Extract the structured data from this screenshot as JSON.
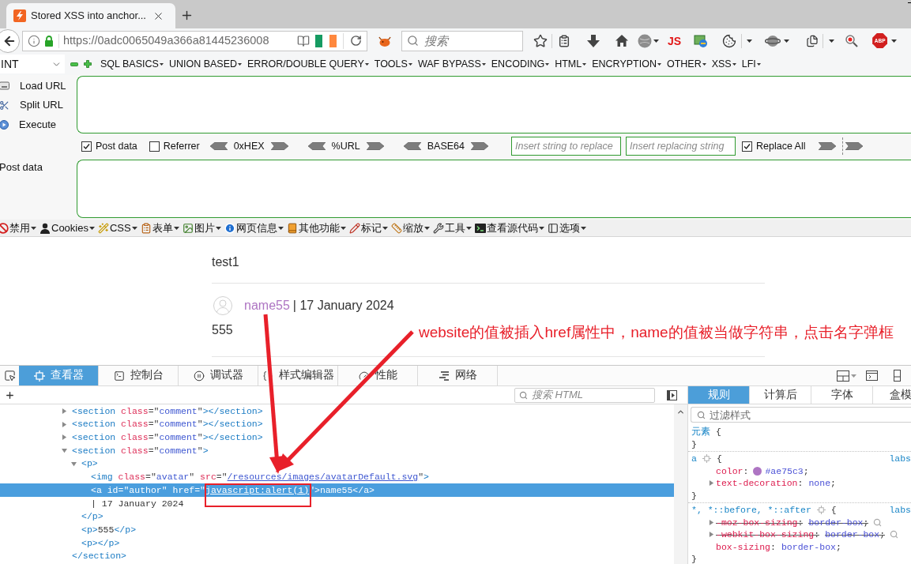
{
  "browser": {
    "tabs": [
      {
        "title": "Stored XSS into anchor...",
        "selected": true
      }
    ],
    "url": "https://0adc0065049a366a81445236008",
    "search_placeholder": "搜索",
    "js_label": "JS",
    "abp_label": "ABP"
  },
  "hackbar": {
    "load_type": "INT",
    "menus": [
      "SQL BASICS",
      "UNION BASED",
      "ERROR/DOUBLE QUERY",
      "TOOLS",
      "WAF BYPASS",
      "ENCODING",
      "HTML",
      "ENCRYPTION",
      "OTHER",
      "XSS",
      "LFI"
    ],
    "actions": [
      "Load URL",
      "Split URL",
      "Execute"
    ],
    "checkboxes": [
      {
        "label": "Post data",
        "checked": true
      },
      {
        "label": "Referrer",
        "checked": false
      }
    ],
    "encoders": [
      "0xHEX",
      "%URL",
      "BASE64"
    ],
    "replace_from_placeholder": "Insert string to replace",
    "replace_to_placeholder": "Insert replacing string",
    "replace_all": {
      "label": "Replace All",
      "checked": true
    },
    "post_data_label": "Post data"
  },
  "dev_toolbar": [
    "禁用",
    "Cookies",
    "CSS",
    "表单",
    "图片",
    "网页信息",
    "其他功能",
    "标记",
    "缩放",
    "工具",
    "查看源代码",
    "选项"
  ],
  "page": {
    "comments": [
      {
        "body": "test1"
      },
      {
        "author": "name55",
        "meta": "| 17 January 2024",
        "body": "555"
      }
    ]
  },
  "annotation": "website的值被插入href属性中，name的值被当做字符串，点击名字弹框",
  "devtools": {
    "tabs": [
      {
        "label": "查看器",
        "selected": true
      },
      {
        "label": "控制台",
        "selected": false
      },
      {
        "label": "调试器",
        "selected": false
      },
      {
        "label": "样式编辑器",
        "selected": false
      },
      {
        "label": "性能",
        "selected": false
      },
      {
        "label": "网络",
        "selected": false
      }
    ],
    "search_placeholder": "搜索 HTML",
    "markup": [
      {
        "kind": "parent",
        "expanded": false,
        "selected": false,
        "tokens": [
          {
            "kind": "tag",
            "text": "<section"
          },
          {
            "kind": "attr",
            "text": " class"
          },
          {
            "kind": "punct",
            "text": "=\""
          },
          {
            "kind": "value",
            "text": "comment"
          },
          {
            "kind": "punct",
            "text": "\""
          },
          {
            "kind": "tag",
            "text": "></section>"
          }
        ]
      },
      {
        "kind": "parent",
        "expanded": false,
        "selected": false,
        "tokens": [
          {
            "kind": "tag",
            "text": "<section"
          },
          {
            "kind": "attr",
            "text": " class"
          },
          {
            "kind": "punct",
            "text": "=\""
          },
          {
            "kind": "value",
            "text": "comment"
          },
          {
            "kind": "punct",
            "text": "\""
          },
          {
            "kind": "tag",
            "text": "></section>"
          }
        ]
      },
      {
        "kind": "parent",
        "expanded": false,
        "selected": false,
        "tokens": [
          {
            "kind": "tag",
            "text": "<section"
          },
          {
            "kind": "attr",
            "text": " class"
          },
          {
            "kind": "punct",
            "text": "=\""
          },
          {
            "kind": "value",
            "text": "comment"
          },
          {
            "kind": "punct",
            "text": "\""
          },
          {
            "kind": "tag",
            "text": "></section>"
          }
        ]
      },
      {
        "kind": "parent",
        "expanded": true,
        "selected": false,
        "tokens": [
          {
            "kind": "tag",
            "text": "<section"
          },
          {
            "kind": "attr",
            "text": " class"
          },
          {
            "kind": "punct",
            "text": "=\""
          },
          {
            "kind": "value",
            "text": "comment"
          },
          {
            "kind": "punct",
            "text": "\""
          },
          {
            "kind": "tag",
            "text": ">"
          }
        ],
        "children": [
          {
            "kind": "parent",
            "expanded": true,
            "selected": false,
            "tokens": [
              {
                "kind": "tag",
                "text": "<p>"
              }
            ],
            "children": [
              {
                "kind": "leaf",
                "selected": false,
                "tokens": [
                  {
                    "kind": "tag",
                    "text": "<img"
                  },
                  {
                    "kind": "attr",
                    "text": " class"
                  },
                  {
                    "kind": "punct",
                    "text": "=\""
                  },
                  {
                    "kind": "value",
                    "text": "avatar"
                  },
                  {
                    "kind": "punct",
                    "text": "\""
                  },
                  {
                    "kind": "attr",
                    "text": " src"
                  },
                  {
                    "kind": "punct",
                    "text": "=\""
                  },
                  {
                    "kind": "link",
                    "text": "/resources/images/avatarDefault.svg"
                  },
                  {
                    "kind": "punct",
                    "text": "\""
                  },
                  {
                    "kind": "tag",
                    "text": ">"
                  }
                ]
              },
              {
                "kind": "leaf",
                "selected": true,
                "tokens": [
                  {
                    "kind": "tag",
                    "text": "<a"
                  },
                  {
                    "kind": "attr",
                    "text": " id"
                  },
                  {
                    "kind": "punct",
                    "text": "=\""
                  },
                  {
                    "kind": "value",
                    "text": "author"
                  },
                  {
                    "kind": "punct",
                    "text": "\""
                  },
                  {
                    "kind": "attr",
                    "text": " href"
                  },
                  {
                    "kind": "punct",
                    "text": "=\""
                  },
                  {
                    "kind": "link",
                    "text": "javascript:alert(1)"
                  },
                  {
                    "kind": "punct",
                    "text": "\""
                  },
                  {
                    "kind": "tag",
                    "text": ">"
                  },
                  {
                    "kind": "text",
                    "text": "name55"
                  },
                  {
                    "kind": "tag",
                    "text": "</a>"
                  }
                ]
              },
              {
                "kind": "leaf",
                "selected": false,
                "tokens": [
                  {
                    "kind": "text",
                    "text": "| 17 January 2024"
                  }
                ]
              }
            ],
            "closing": [
              {
                "kind": "tag",
                "text": "</p>"
              }
            ]
          },
          {
            "kind": "leaf",
            "selected": false,
            "tokens": [
              {
                "kind": "tag",
                "text": "<p>"
              },
              {
                "kind": "text",
                "text": "555"
              },
              {
                "kind": "tag",
                "text": "</p>"
              }
            ]
          },
          {
            "kind": "leaf",
            "selected": false,
            "tokens": [
              {
                "kind": "tag",
                "text": "<p></p>"
              }
            ]
          }
        ],
        "closing": [
          {
            "kind": "tag",
            "text": "</section>"
          }
        ]
      }
    ],
    "rules_tabs": [
      {
        "label": "规则",
        "selected": true
      },
      {
        "label": "计算后",
        "selected": false
      },
      {
        "label": "字体",
        "selected": false
      },
      {
        "label": "盒模",
        "selected": false
      }
    ],
    "filter_placeholder": "过滤样式",
    "rules": [
      {
        "selector": "元素",
        "open": "{",
        "close": "}"
      },
      {
        "selector": "a",
        "open": "{",
        "source": "labs",
        "close": "}",
        "declarations": [
          {
            "property": "color",
            "colon": ":",
            "value": "#ae75c3",
            "end": ";",
            "color": "#ae75c3",
            "expandable": false,
            "overridden": false
          },
          {
            "property": "text-decoration",
            "colon": ":",
            "value": "none",
            "end": ";",
            "expandable": true,
            "overridden": false
          }
        ]
      },
      {
        "selector": "*, *::before, *::after",
        "open": "{",
        "source": "labs",
        "close": "}",
        "declarations": [
          {
            "property": "-moz-box-sizing",
            "colon": ":",
            "value": "border-box",
            "end": ";",
            "expandable": true,
            "overridden": true
          },
          {
            "property": "-webkit-box-sizing",
            "colon": ":",
            "value": "border-box",
            "end": ";",
            "expandable": true,
            "overridden": true
          },
          {
            "property": "box-sizing",
            "colon": ":",
            "value": "border-box",
            "end": ";",
            "expandable": false,
            "overridden": false
          }
        ]
      }
    ]
  }
}
